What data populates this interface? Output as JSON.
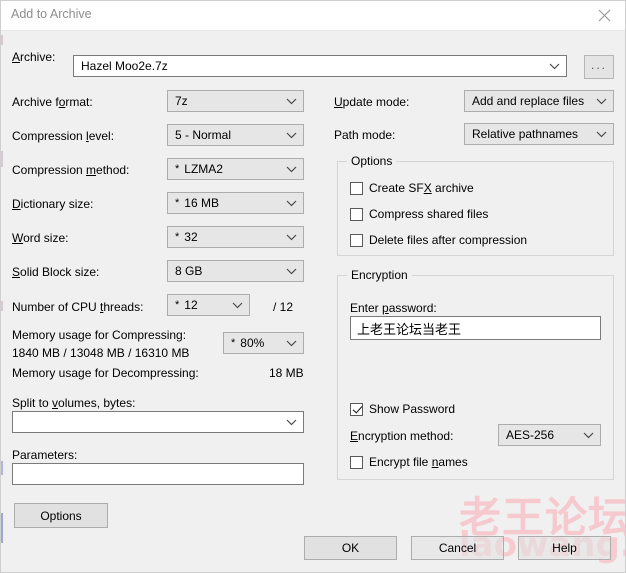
{
  "window": {
    "title": "Add to Archive",
    "close_icon": "close-icon"
  },
  "archive": {
    "label": "Archive:",
    "value": "Hazel Moo2e.7z",
    "browse_label": "..."
  },
  "left_fields": [
    {
      "label": "Archive format:",
      "value": "7z",
      "star": false
    },
    {
      "label": "Compression level:",
      "value": "5 - Normal",
      "star": false
    },
    {
      "label": "Compression method:",
      "value": "LZMA2",
      "star": true
    },
    {
      "label": "Dictionary size:",
      "value": "16 MB",
      "star": true
    },
    {
      "label": "Word size:",
      "value": "32",
      "star": true
    },
    {
      "label": "Solid Block size:",
      "value": "8 GB",
      "star": false
    }
  ],
  "cpu": {
    "label": "Number of CPU threads:",
    "value": "12",
    "star": true,
    "total": "/ 12"
  },
  "memory": {
    "compress_label": "Memory usage for Compressing:",
    "compress_value": "1840 MB / 13048 MB / 16310 MB",
    "percent": "80%",
    "percent_star": true,
    "decompress_label": "Memory usage for Decompressing:",
    "decompress_value": "18 MB"
  },
  "split": {
    "label": "Split to volumes, bytes:",
    "value": ""
  },
  "parameters": {
    "label": "Parameters:",
    "value": ""
  },
  "right_fields": [
    {
      "label": "Update mode:",
      "value": "Add and replace files"
    },
    {
      "label": "Path mode:",
      "value": "Relative pathnames"
    }
  ],
  "options_group": {
    "title": "Options",
    "checkboxes": [
      {
        "label": "Create SFX archive",
        "checked": false
      },
      {
        "label": "Compress shared files",
        "checked": false
      },
      {
        "label": "Delete files after compression",
        "checked": false
      }
    ]
  },
  "encryption_group": {
    "title": "Encryption",
    "password_label": "Enter password:",
    "password_value": "上老王论坛当老王",
    "show_password": {
      "label": "Show Password",
      "checked": true
    },
    "method_label": "Encryption method:",
    "method_value": "AES-256",
    "encrypt_names": {
      "label": "Encrypt file names",
      "checked": false
    }
  },
  "buttons": {
    "options": "Options",
    "ok": "OK",
    "cancel": "Cancel",
    "help": "Help"
  },
  "watermark": {
    "cn": "老王论坛",
    "en": "laowang.vip",
    "color": "#f6c9ce"
  }
}
